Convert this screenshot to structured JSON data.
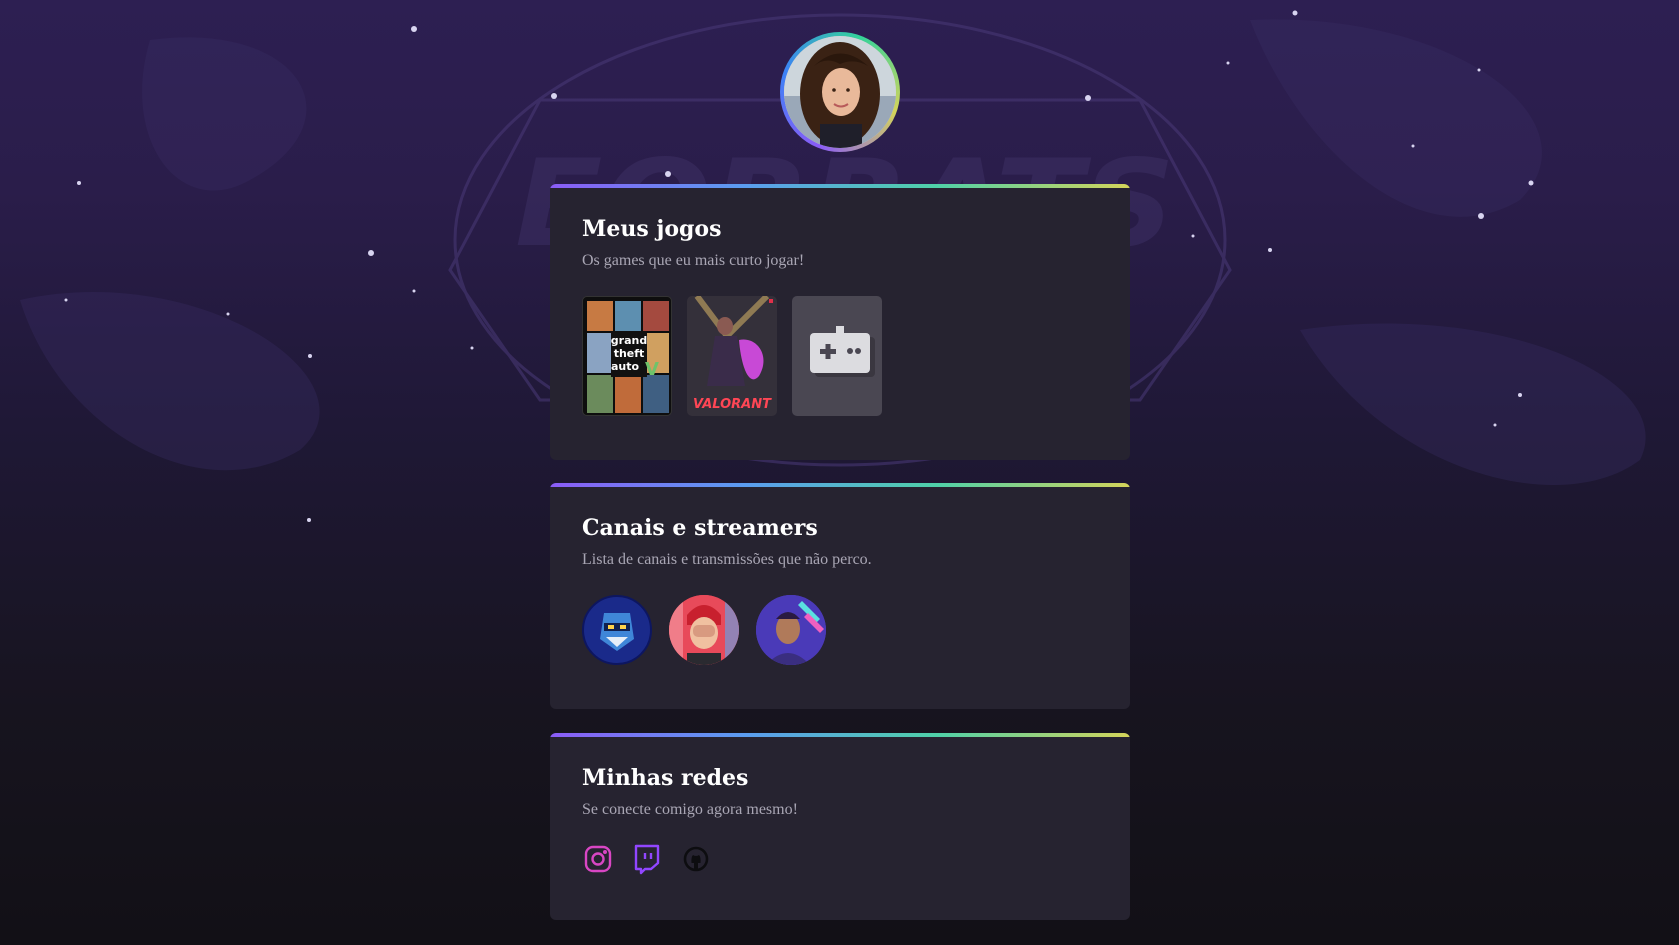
{
  "profile": {
    "avatar_icon": "profile-photo"
  },
  "games_card": {
    "title": "Meus jogos",
    "subtitle": "Os games que eu mais curto jogar!",
    "games": [
      {
        "name": "gta-v-cover",
        "logo_text": [
          "grand",
          "theft",
          "auto"
        ],
        "logo_mark": "V"
      },
      {
        "name": "valorant-cover",
        "logo_text": "VALORANT"
      },
      {
        "name": "gamepad-placeholder",
        "icon": "gamepad-icon"
      }
    ]
  },
  "streamers_card": {
    "title": "Canais e streamers",
    "subtitle": "Lista de canais e transmissões que não perco.",
    "streamers": [
      "streamer-avatar-1",
      "streamer-avatar-2",
      "streamer-avatar-3"
    ]
  },
  "social_card": {
    "title": "Minhas redes",
    "subtitle": "Se conecte comigo agora mesmo!",
    "links": [
      {
        "icon": "instagram-icon",
        "color": "#d946c4"
      },
      {
        "icon": "twitch-icon",
        "color": "#9146ff"
      },
      {
        "icon": "github-icon",
        "color": "#111111"
      }
    ]
  },
  "colors": {
    "card_bg": "#262330",
    "accent_gradient": [
      "#8b5cf6",
      "#5b9cf0",
      "#4fd1a8",
      "#d4d45a"
    ]
  }
}
